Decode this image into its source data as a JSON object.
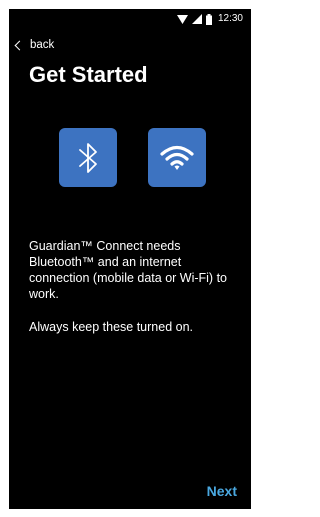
{
  "colors": {
    "background": "#000000",
    "text": "#ffffff",
    "tile": "#3d73c1",
    "accent": "#4aa8e0"
  },
  "status_bar": {
    "time": "12:30",
    "icons": [
      "wifi-signal-icon",
      "cellular-signal-icon",
      "battery-icon"
    ]
  },
  "nav": {
    "back_label": "back"
  },
  "title": "Get Started",
  "icons": [
    {
      "name": "bluetooth-icon"
    },
    {
      "name": "wifi-icon"
    }
  ],
  "body": {
    "paragraph1": "Guardian™ Connect needs Bluetooth™ and an internet connection (mobile data or Wi-Fi) to work.",
    "paragraph2": "Always keep these turned on."
  },
  "footer": {
    "next_label": "Next"
  }
}
